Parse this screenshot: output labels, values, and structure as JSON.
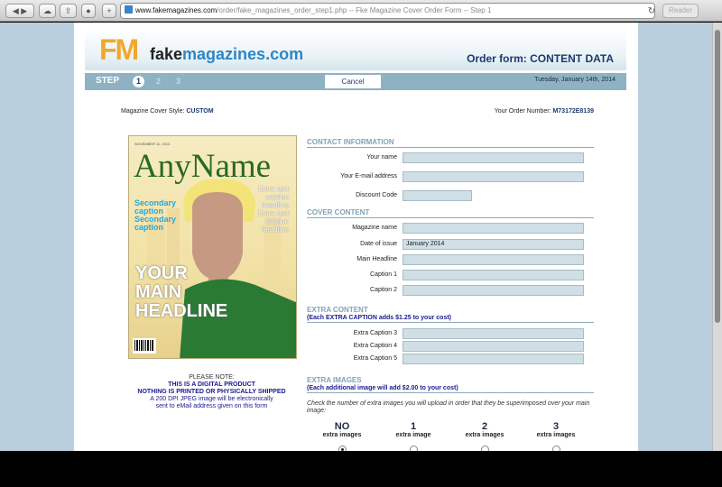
{
  "browser": {
    "url_host": "www.fakemagazines.com",
    "url_path": "/order/fake_magazines_order_step1.php -- Fke Magazine Cover Order Form -- Step 1",
    "reader_label": "Reader"
  },
  "header": {
    "logo_mark": "FM",
    "logo_name_a": "fake",
    "logo_name_b": "magazines.com",
    "order_title": "Order form: CONTENT DATA"
  },
  "stepbar": {
    "label": "STEP",
    "steps": [
      "1",
      "2",
      "3"
    ],
    "active_step": "1",
    "cancel_label": "Cancel",
    "date": "Tuesday, January 14th, 2014"
  },
  "meta": {
    "style_label": "Magazine Cover Style:",
    "style_value": "CUSTOM",
    "order_label": "Your Order Number:",
    "order_value": "M73172E8139"
  },
  "cover": {
    "small_text": "NOVEMBER 11, 2013",
    "title": "AnyName",
    "secondary": "Secondary caption Secondary caption",
    "extra": "Extra text caption headline Extra text caption headline",
    "main_headline": "YOUR MAIN HEADLINE"
  },
  "note": {
    "title": "PLEASE NOTE:",
    "line1": "THIS IS A DIGITAL PRODUCT",
    "line2": "NOTHING IS PRINTED OR PHYSICALLY SHIPPED",
    "line3": "A 200 DPI JPEG image will be electronically",
    "line4": "sent to eMail address given on this form"
  },
  "form": {
    "contact_title": "CONTACT INFORMATION",
    "name_label": "Your name",
    "name_value": "",
    "email_label": "Your E-mail address",
    "email_value": "",
    "discount_label": "Discount Code",
    "discount_value": "",
    "cover_title": "COVER CONTENT",
    "magazine_label": "Magazine name",
    "magazine_value": "",
    "date_label": "Date of issue",
    "date_value": "January 2014",
    "headline_label": "Main Headline",
    "headline_value": "",
    "caption1_label": "Caption 1",
    "caption1_value": "",
    "caption2_label": "Caption 2",
    "caption2_value": "",
    "extra_title": "EXTRA CONTENT",
    "extra_sub": "(Each EXTRA CAPTION adds $1.25 to your cost)",
    "extra3_label": "Extra Caption 3",
    "extra3_value": "",
    "extra4_label": "Extra Caption 4",
    "extra4_value": "",
    "extra5_label": "Extra Caption 5",
    "extra5_value": "",
    "images_title": "EXTRA IMAGES",
    "images_sub": "(Each additional image will add $2.00 to your cost)",
    "images_help": "Check the number of extra images you will upload in order that they be superimposed over your main image:",
    "options": [
      {
        "num": "NO",
        "sub": "extra images"
      },
      {
        "num": "1",
        "sub": "extra image"
      },
      {
        "num": "2",
        "sub": "extra images"
      },
      {
        "num": "3",
        "sub": "extra images"
      }
    ],
    "selected_option": "NO"
  }
}
